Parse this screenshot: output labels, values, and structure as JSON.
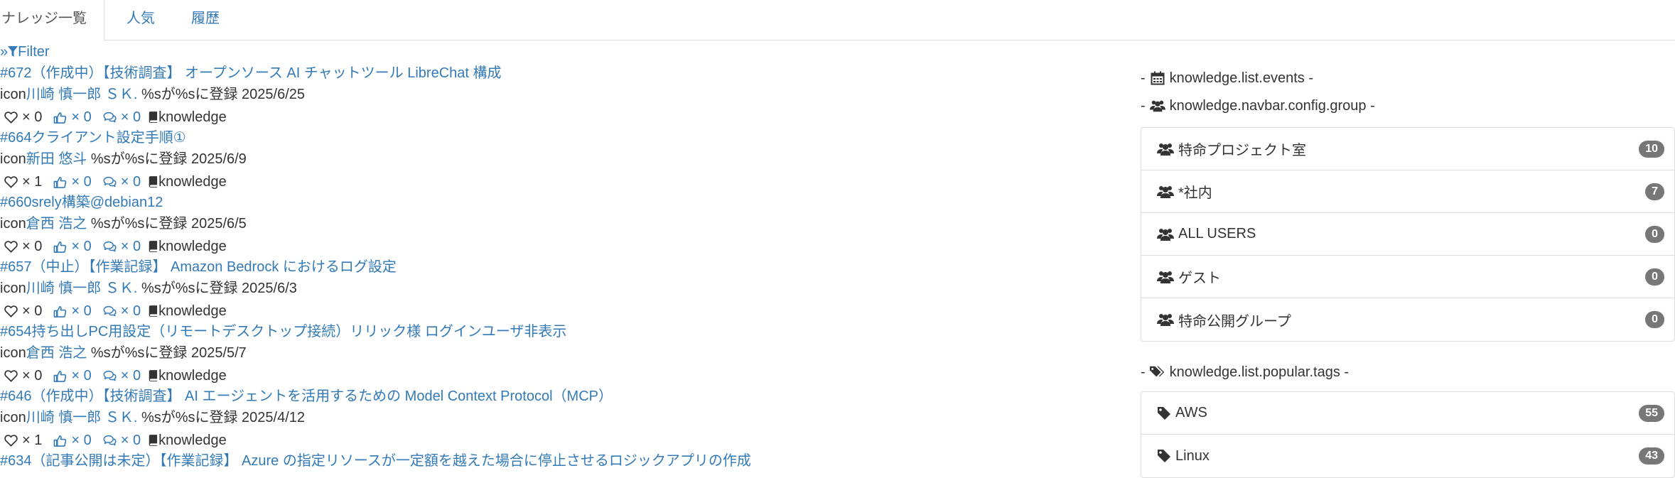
{
  "tabs": [
    {
      "label": "ナレッジ一覧",
      "active": true
    },
    {
      "label": "人気",
      "active": false
    },
    {
      "label": "履歴",
      "active": false
    }
  ],
  "filter": {
    "label": "Filter"
  },
  "entries": [
    {
      "title": "#672（作成中）【技術調査】 オープンソース AI チャットツール LibreChat 構成",
      "author": "川崎 慎一郎 ＳＫ.",
      "registered": "%sが%sに登録 2025/6/25",
      "likes": "× 0",
      "points": "× 0",
      "comments": "× 0",
      "template": "knowledge"
    },
    {
      "title": "#664クライアント設定手順①",
      "author": "新田 悠斗",
      "registered": "%sが%sに登録 2025/6/9",
      "likes": "× 1",
      "points": "× 0",
      "comments": "× 0",
      "template": "knowledge"
    },
    {
      "title": "#660srely構築@debian12",
      "author": "倉西 浩之",
      "registered": "%sが%sに登録 2025/6/5",
      "likes": "× 0",
      "points": "× 0",
      "comments": "× 0",
      "template": "knowledge"
    },
    {
      "title": "#657（中止）【作業記録】 Amazon Bedrock におけるログ設定",
      "author": "川崎 慎一郎 ＳＫ.",
      "registered": "%sが%sに登録 2025/6/3",
      "likes": "× 0",
      "points": "× 0",
      "comments": "× 0",
      "template": "knowledge"
    },
    {
      "title": "#654持ち出しPC用設定（リモートデスクトップ接続）リリック様 ログインユーザ非表示",
      "author": "倉西 浩之",
      "registered": "%sが%sに登録 2025/5/7",
      "likes": "× 0",
      "points": "× 0",
      "comments": "× 0",
      "template": "knowledge"
    },
    {
      "title": "#646（作成中）【技術調査】 AI エージェントを活用するための Model Context Protocol（MCP）",
      "author": "川崎 慎一郎 ＳＫ.",
      "registered": "%sが%sに登録 2025/4/12",
      "likes": "× 1",
      "points": "× 0",
      "comments": "× 0",
      "template": "knowledge"
    },
    {
      "title": "#634（記事公開は未定）【作業記録】 Azure の指定リソースが一定額を越えた場合に停止させるロジックアプリの作成",
      "author": "",
      "registered": "",
      "likes": "",
      "points": "",
      "comments": "",
      "template": ""
    }
  ],
  "icon_alt": "icon",
  "sidebar": {
    "events_label": "knowledge.list.events",
    "groups_label": "knowledge.navbar.config.group",
    "groups": [
      {
        "name": "特命プロジェクト室",
        "count": "10"
      },
      {
        "name": "*社内",
        "count": "7"
      },
      {
        "name": "ALL USERS",
        "count": "0"
      },
      {
        "name": "ゲスト",
        "count": "0"
      },
      {
        "name": "特命公開グループ",
        "count": "0"
      }
    ],
    "tags_label": "knowledge.list.popular.tags",
    "tags": [
      {
        "name": "AWS",
        "count": "55"
      },
      {
        "name": "Linux",
        "count": "43"
      }
    ]
  },
  "colors": {
    "link": "#337ab7",
    "badge": "#777777",
    "border": "#dddddd"
  }
}
